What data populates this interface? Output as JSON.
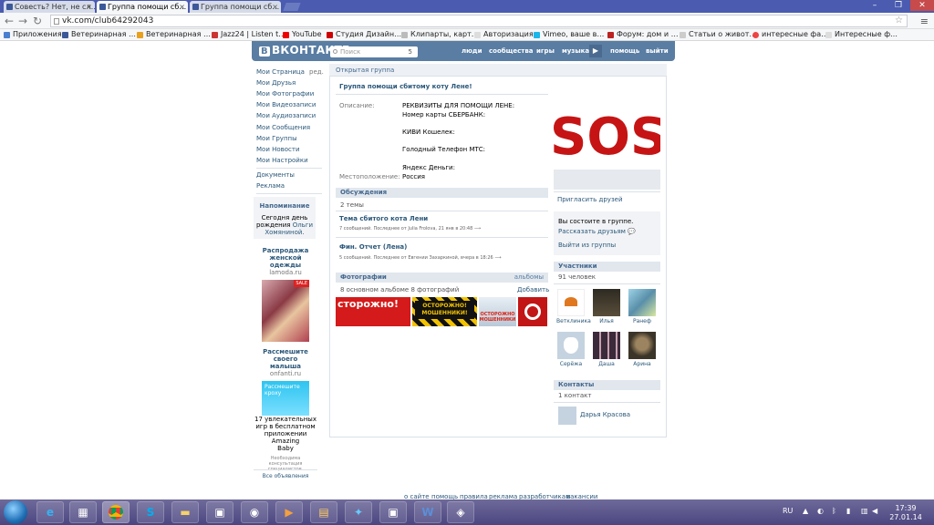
{
  "browser": {
    "tabs": [
      {
        "title": "Совесть? Нет, не сл…"
      },
      {
        "title": "Группа помощи сб…"
      },
      {
        "title": "Группа помощи сб…"
      }
    ],
    "url": "vk.com/club64292043",
    "bookmarks": [
      "Приложения",
      "Ветеринарная …",
      "Ветеринарная …",
      "Jazz24 | Listen t…",
      "YouTube",
      "Студия Дизайн…",
      "Клипарты, карт…",
      "Авторизация",
      "Vimeo, ваше в…",
      "Форум: дом и …",
      "Статьи о живот…",
      "интересные фа…",
      "Интересные ф…"
    ]
  },
  "vk": {
    "logo": "ВКОНТАКТЕ",
    "logo_mark": "В",
    "search_placeholder": "Поиск",
    "search_count": "5",
    "nav": [
      "люди",
      "сообщества",
      "игры",
      "музыка",
      "помощь",
      "выйти"
    ],
    "left_menu": [
      "Мои Страница",
      "Мои Друзья",
      "Мои Фотографии",
      "Мои Видеозаписи",
      "Мои Аудиозаписи",
      "Мои Сообщения",
      "Мои Группы",
      "Мои Новости",
      "Мои Настройки"
    ],
    "left_menu_edit": "ред.",
    "left_extra": [
      "Документы",
      "Реклама"
    ],
    "reminder": {
      "title": "Напоминание",
      "text1": "Сегодня день",
      "text2": "рождения",
      "name1": "Ольги",
      "name2": "Хомяниной."
    },
    "ads": [
      {
        "title1": "Распродажа",
        "title2": "женской одежды",
        "site": "lamoda.ru",
        "badge": "SALE"
      },
      {
        "title1": "Рассмешите своего",
        "title2": "малыша",
        "site": "onfanti.ru",
        "banner": "Рассмешите кроху"
      },
      {
        "text1": "17 увлекательных",
        "text2": "игр в бесплатном",
        "text3": "приложении Amazing",
        "text4": "Baby",
        "note1": "Необходима",
        "note2": "консультация",
        "note3": "специалистов."
      }
    ],
    "all_ads": "Все объявления",
    "group_type": "Открытая группа",
    "group_title": "Группа помощи сбитому коту Лене!",
    "description_label": "Описание:",
    "description": [
      "РЕКВИЗИТЫ ДЛЯ ПОМОЩИ ЛЕНЕ:",
      "Номер карты СБЕРБАНК:",
      "",
      "КИВИ Кошелек:",
      "",
      "Голодный Телефон МТС:",
      "",
      "Яндекс Деньги:"
    ],
    "location_label": "Местоположение:",
    "location": "Россия",
    "discussions": {
      "title": "Обсуждения",
      "count": "2 темы",
      "topics": [
        {
          "title": "Тема сбитого кота Лени",
          "meta": "7 сообщений. Последнее от Julia Frolova, 21 янв в 20:48"
        },
        {
          "title": "Фин. Отчет (Лена)",
          "meta": "5 сообщений. Последнее от Евгении Захаркиной, вчера в 18:26"
        }
      ]
    },
    "photos": {
      "title": "Фотографии",
      "right": "альбомы",
      "count": "8 основном альбоме 8 фотографий",
      "add": "Добавить",
      "p1": "сторожно!",
      "p2a": "ОСТОРОЖНО!",
      "p2b": "МОШЕННИКИ!",
      "p3": "ОСТОРОЖНО МОШЕННИКИ"
    },
    "cover_text": "SOS",
    "invite": "Пригласить друзей",
    "membership": {
      "status": "Вы состоите в группе.",
      "tell": "Рассказать друзьям",
      "leave": "Выйти из группы"
    },
    "members": {
      "title": "Участники",
      "count": "91 человек",
      "people": [
        "Ветклиника",
        "Илья",
        "Ранеф",
        "Серёжа",
        "Даша",
        "Арина"
      ]
    },
    "contacts": {
      "title": "Контакты",
      "count": "1 контакт",
      "person": "Дарья Краcова"
    },
    "footer": [
      "о сайте",
      "помощь",
      "правила",
      "реклама",
      "разработчикам",
      "вакансии"
    ]
  },
  "taskbar": {
    "lang": "RU",
    "time": "17:39",
    "date": "27.01.14"
  },
  "colors": {
    "vk_blue": "#597da3",
    "link": "#2b587a",
    "bar": "#e1e7ed"
  }
}
